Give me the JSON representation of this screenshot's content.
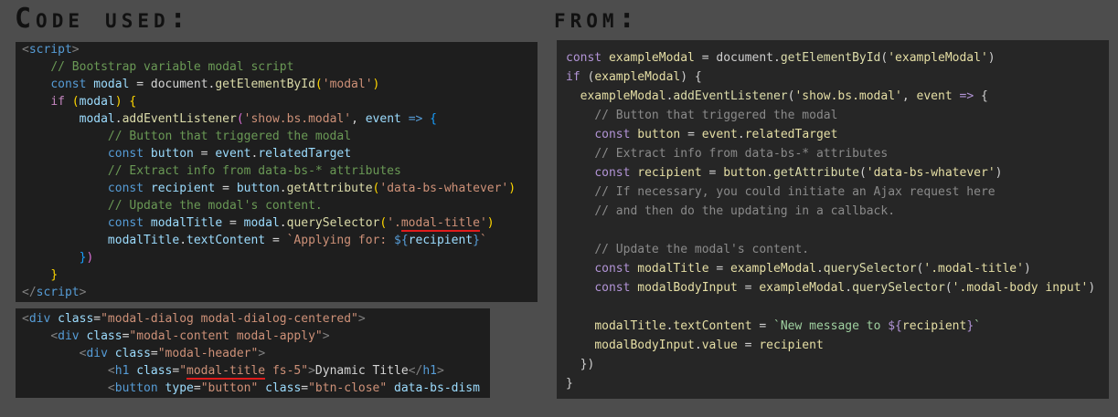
{
  "headings": {
    "left": "Code used:",
    "right": "from:"
  },
  "colors": {
    "background": "#4d4d4d",
    "panel_dark": "#1e1e1e",
    "panel_right": "#262626",
    "underline": "#e01b1b"
  },
  "panel_a": {
    "lines": [
      [
        [
          "t-tag",
          "<"
        ],
        [
          "t-tagname",
          "script"
        ],
        [
          "t-tag",
          ">"
        ]
      ],
      [
        [
          "t-plain",
          "    "
        ],
        [
          "t-cmt",
          "// Bootstrap variable modal script"
        ]
      ],
      [
        [
          "t-plain",
          "    "
        ],
        [
          "t-kw",
          "const"
        ],
        [
          "t-plain",
          " "
        ],
        [
          "t-var",
          "modal"
        ],
        [
          "t-plain",
          " = document."
        ],
        [
          "t-fn",
          "getElementById"
        ],
        [
          "t-brk",
          "("
        ],
        [
          "t-str",
          "'modal'"
        ],
        [
          "t-brk",
          ")"
        ]
      ],
      [
        [
          "t-plain",
          "    "
        ],
        [
          "t-ctl",
          "if"
        ],
        [
          "t-plain",
          " "
        ],
        [
          "t-brk",
          "("
        ],
        [
          "t-var",
          "modal"
        ],
        [
          "t-brk",
          ")"
        ],
        [
          "t-plain",
          " "
        ],
        [
          "t-brk",
          "{"
        ]
      ],
      [
        [
          "t-plain",
          "        "
        ],
        [
          "t-var",
          "modal"
        ],
        [
          "t-plain",
          "."
        ],
        [
          "t-fn",
          "addEventListener"
        ],
        [
          "t-brk2",
          "("
        ],
        [
          "t-str",
          "'show.bs.modal'"
        ],
        [
          "t-plain",
          ", "
        ],
        [
          "t-var",
          "event"
        ],
        [
          "t-plain",
          " "
        ],
        [
          "t-kw",
          "=>"
        ],
        [
          "t-plain",
          " "
        ],
        [
          "t-brk3",
          "{"
        ]
      ],
      [
        [
          "t-plain",
          "            "
        ],
        [
          "t-cmt",
          "// Button that triggered the modal"
        ]
      ],
      [
        [
          "t-plain",
          "            "
        ],
        [
          "t-kw",
          "const"
        ],
        [
          "t-plain",
          " "
        ],
        [
          "t-var",
          "button"
        ],
        [
          "t-plain",
          " = "
        ],
        [
          "t-var",
          "event"
        ],
        [
          "t-plain",
          "."
        ],
        [
          "t-var",
          "relatedTarget"
        ]
      ],
      [
        [
          "t-plain",
          "            "
        ],
        [
          "t-cmt",
          "// Extract info from data-bs-* attributes"
        ]
      ],
      [
        [
          "t-plain",
          "            "
        ],
        [
          "t-kw",
          "const"
        ],
        [
          "t-plain",
          " "
        ],
        [
          "t-var",
          "recipient"
        ],
        [
          "t-plain",
          " = "
        ],
        [
          "t-var",
          "button"
        ],
        [
          "t-plain",
          "."
        ],
        [
          "t-fn",
          "getAttribute"
        ],
        [
          "t-brk",
          "("
        ],
        [
          "t-str",
          "'data-bs-whatever'"
        ],
        [
          "t-brk",
          ")"
        ]
      ],
      [
        [
          "t-plain",
          "            "
        ],
        [
          "t-cmt",
          "// Update the modal's content."
        ]
      ],
      [
        [
          "t-plain",
          "            "
        ],
        [
          "t-kw",
          "const"
        ],
        [
          "t-plain",
          " "
        ],
        [
          "t-var",
          "modalTitle"
        ],
        [
          "t-plain",
          " = "
        ],
        [
          "t-var",
          "modal"
        ],
        [
          "t-plain",
          "."
        ],
        [
          "t-fn",
          "querySelector"
        ],
        [
          "t-brk",
          "("
        ],
        [
          "t-str",
          "'."
        ],
        [
          "t-str u",
          "modal-title"
        ],
        [
          "t-str",
          "'"
        ],
        [
          "t-brk",
          ")"
        ]
      ],
      [
        [
          "t-plain",
          "            "
        ],
        [
          "t-var",
          "modalTitle"
        ],
        [
          "t-plain",
          "."
        ],
        [
          "t-var",
          "textContent"
        ],
        [
          "t-plain",
          " = "
        ],
        [
          "t-str",
          "`Applying for: "
        ],
        [
          "t-kw",
          "${"
        ],
        [
          "t-var",
          "recipient"
        ],
        [
          "t-kw",
          "}"
        ],
        [
          "t-str",
          "`"
        ]
      ],
      [
        [
          "t-plain",
          "        "
        ],
        [
          "t-brk3",
          "}"
        ],
        [
          "t-brk2",
          ")"
        ]
      ],
      [
        [
          "t-plain",
          "    "
        ],
        [
          "t-brk",
          "}"
        ]
      ],
      [
        [
          "t-tag",
          "</"
        ],
        [
          "t-tagname",
          "script"
        ],
        [
          "t-tag",
          ">"
        ]
      ]
    ]
  },
  "panel_b": {
    "lines": [
      [
        [
          "t-tag",
          "<"
        ],
        [
          "t-tagname",
          "div"
        ],
        [
          "t-plain",
          " "
        ],
        [
          "t-attr",
          "class"
        ],
        [
          "t-plain",
          "="
        ],
        [
          "t-str",
          "\"modal-dialog modal-dialog-centered\""
        ],
        [
          "t-tag",
          ">"
        ]
      ],
      [
        [
          "t-plain",
          "    "
        ],
        [
          "t-tag",
          "<"
        ],
        [
          "t-tagname",
          "div"
        ],
        [
          "t-plain",
          " "
        ],
        [
          "t-attr",
          "class"
        ],
        [
          "t-plain",
          "="
        ],
        [
          "t-str",
          "\"modal-content modal-apply\""
        ],
        [
          "t-tag",
          ">"
        ]
      ],
      [
        [
          "t-plain",
          "        "
        ],
        [
          "t-tag",
          "<"
        ],
        [
          "t-tagname",
          "div"
        ],
        [
          "t-plain",
          " "
        ],
        [
          "t-attr",
          "class"
        ],
        [
          "t-plain",
          "="
        ],
        [
          "t-str",
          "\"modal-header\""
        ],
        [
          "t-tag",
          ">"
        ]
      ],
      [
        [
          "t-plain",
          "            "
        ],
        [
          "t-tag",
          "<"
        ],
        [
          "t-tagname",
          "h1"
        ],
        [
          "t-plain",
          " "
        ],
        [
          "t-attr",
          "class"
        ],
        [
          "t-plain",
          "="
        ],
        [
          "t-str",
          "\""
        ],
        [
          "t-str u",
          "modal-title"
        ],
        [
          "t-str",
          " fs-5\""
        ],
        [
          "t-tag",
          ">"
        ],
        [
          "t-plain",
          "Dynamic Title"
        ],
        [
          "t-tag",
          "</"
        ],
        [
          "t-tagname",
          "h1"
        ],
        [
          "t-tag",
          ">"
        ]
      ],
      [
        [
          "t-plain",
          "            "
        ],
        [
          "t-tag",
          "<"
        ],
        [
          "t-tagname",
          "button"
        ],
        [
          "t-plain",
          " "
        ],
        [
          "t-attr",
          "type"
        ],
        [
          "t-plain",
          "="
        ],
        [
          "t-str",
          "\"button\""
        ],
        [
          "t-plain",
          " "
        ],
        [
          "t-attr",
          "class"
        ],
        [
          "t-plain",
          "="
        ],
        [
          "t-str",
          "\"btn-close\""
        ],
        [
          "t-plain",
          " "
        ],
        [
          "t-attr",
          "data-bs-dism"
        ]
      ]
    ]
  },
  "panel_c": {
    "lines": [
      [
        [
          "t-kw",
          "const"
        ],
        [
          "t-plain",
          " "
        ],
        [
          "t-var",
          "exampleModal"
        ],
        [
          "t-plain",
          " = document."
        ],
        [
          "t-fn",
          "getElementById"
        ],
        [
          "t-plain",
          "("
        ],
        [
          "t-str",
          "'exampleModal'"
        ],
        [
          "t-plain",
          ")"
        ]
      ],
      [
        [
          "t-kw",
          "if"
        ],
        [
          "t-plain",
          " ("
        ],
        [
          "t-var",
          "exampleModal"
        ],
        [
          "t-plain",
          ") {"
        ]
      ],
      [
        [
          "t-plain",
          "  "
        ],
        [
          "t-var",
          "exampleModal"
        ],
        [
          "t-plain",
          "."
        ],
        [
          "t-fn",
          "addEventListener"
        ],
        [
          "t-plain",
          "("
        ],
        [
          "t-str",
          "'show.bs.modal'"
        ],
        [
          "t-plain",
          ", "
        ],
        [
          "t-var",
          "event"
        ],
        [
          "t-plain",
          " "
        ],
        [
          "t-kw",
          "=>"
        ],
        [
          "t-plain",
          " {"
        ]
      ],
      [
        [
          "t-plain",
          "    "
        ],
        [
          "t-cmt",
          "// Button that triggered the modal"
        ]
      ],
      [
        [
          "t-plain",
          "    "
        ],
        [
          "t-kw",
          "const"
        ],
        [
          "t-plain",
          " "
        ],
        [
          "t-var",
          "button"
        ],
        [
          "t-plain",
          " = "
        ],
        [
          "t-var",
          "event"
        ],
        [
          "t-plain",
          "."
        ],
        [
          "t-var",
          "relatedTarget"
        ]
      ],
      [
        [
          "t-plain",
          "    "
        ],
        [
          "t-cmt",
          "// Extract info from data-bs-* attributes"
        ]
      ],
      [
        [
          "t-plain",
          "    "
        ],
        [
          "t-kw",
          "const"
        ],
        [
          "t-plain",
          " "
        ],
        [
          "t-var",
          "recipient"
        ],
        [
          "t-plain",
          " = "
        ],
        [
          "t-var",
          "button"
        ],
        [
          "t-plain",
          "."
        ],
        [
          "t-fn",
          "getAttribute"
        ],
        [
          "t-plain",
          "("
        ],
        [
          "t-str",
          "'data-bs-whatever'"
        ],
        [
          "t-plain",
          ")"
        ]
      ],
      [
        [
          "t-plain",
          "    "
        ],
        [
          "t-cmt",
          "// If necessary, you could initiate an Ajax request here"
        ]
      ],
      [
        [
          "t-plain",
          "    "
        ],
        [
          "t-cmt",
          "// and then do the updating in a callback."
        ]
      ],
      [
        [
          "t-plain",
          ""
        ]
      ],
      [
        [
          "t-plain",
          "    "
        ],
        [
          "t-cmt",
          "// Update the modal's content."
        ]
      ],
      [
        [
          "t-plain",
          "    "
        ],
        [
          "t-kw",
          "const"
        ],
        [
          "t-plain",
          " "
        ],
        [
          "t-var",
          "modalTitle"
        ],
        [
          "t-plain",
          " = "
        ],
        [
          "t-var",
          "exampleModal"
        ],
        [
          "t-plain",
          "."
        ],
        [
          "t-fn",
          "querySelector"
        ],
        [
          "t-plain",
          "("
        ],
        [
          "t-str",
          "'.modal-title'"
        ],
        [
          "t-plain",
          ")"
        ]
      ],
      [
        [
          "t-plain",
          "    "
        ],
        [
          "t-kw",
          "const"
        ],
        [
          "t-plain",
          " "
        ],
        [
          "t-var",
          "modalBodyInput"
        ],
        [
          "t-plain",
          " = "
        ],
        [
          "t-var",
          "exampleModal"
        ],
        [
          "t-plain",
          "."
        ],
        [
          "t-fn",
          "querySelector"
        ],
        [
          "t-plain",
          "("
        ],
        [
          "t-str",
          "'.modal-body input'"
        ],
        [
          "t-plain",
          ")"
        ]
      ],
      [
        [
          "t-plain",
          ""
        ]
      ],
      [
        [
          "t-plain",
          "    "
        ],
        [
          "t-var",
          "modalTitle"
        ],
        [
          "t-plain",
          "."
        ],
        [
          "t-var",
          "textContent"
        ],
        [
          "t-plain",
          " = "
        ],
        [
          "t-tmpl",
          "`New message to "
        ],
        [
          "t-kw",
          "${"
        ],
        [
          "t-var",
          "recipient"
        ],
        [
          "t-kw",
          "}"
        ],
        [
          "t-tmpl",
          "`"
        ]
      ],
      [
        [
          "t-plain",
          "    "
        ],
        [
          "t-var",
          "modalBodyInput"
        ],
        [
          "t-plain",
          "."
        ],
        [
          "t-var",
          "value"
        ],
        [
          "t-plain",
          " = "
        ],
        [
          "t-var",
          "recipient"
        ]
      ],
      [
        [
          "t-plain",
          "  })"
        ]
      ],
      [
        [
          "t-plain",
          "}"
        ]
      ]
    ]
  }
}
